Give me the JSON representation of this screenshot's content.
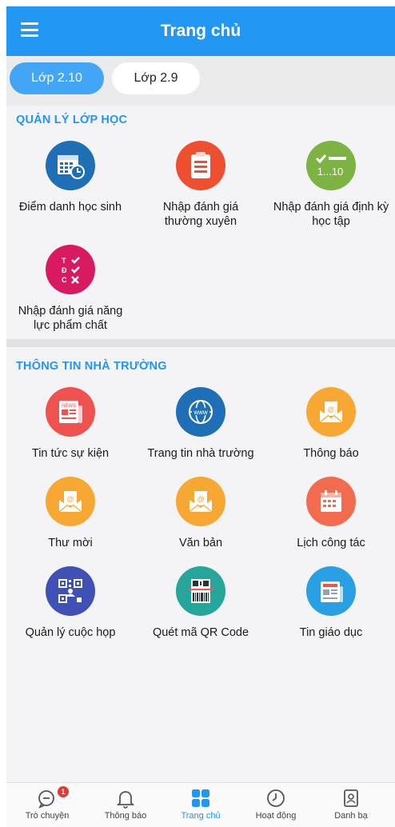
{
  "header": {
    "title": "Trang chủ"
  },
  "tabs": [
    {
      "label": "Lớp 2.10"
    },
    {
      "label": "Lớp 2.9"
    }
  ],
  "section1": {
    "title": "QUẢN LÝ LỚP HỌC",
    "items": [
      {
        "label": "Điểm danh học sinh",
        "icon": "calendar-clock-icon"
      },
      {
        "label": "Nhập đánh giá thường xuyên",
        "icon": "clipboard-icon"
      },
      {
        "label": "Nhập đánh giá định kỳ học tập",
        "icon": "check-score-icon",
        "icon_text": "1...10"
      },
      {
        "label": "Nhập đánh giá năng lực phẩm chất",
        "icon": "tdc-check-icon",
        "icon_text": [
          "T",
          "Đ",
          "C"
        ]
      }
    ]
  },
  "section2": {
    "title": "THÔNG TIN NHÀ TRƯỜNG",
    "items": [
      {
        "label": "Tin tức sự kiện",
        "icon": "newspaper-icon",
        "icon_text": "NEWS"
      },
      {
        "label": "Trang tin nhà trường",
        "icon": "globe-icon",
        "icon_text": "www"
      },
      {
        "label": "Thông báo",
        "icon": "mail-icon"
      },
      {
        "label": "Thư mời",
        "icon": "mail-icon"
      },
      {
        "label": "Văn bản",
        "icon": "mail-icon"
      },
      {
        "label": "Lịch công tác",
        "icon": "calendar-icon"
      },
      {
        "label": "Quản lý cuộc họp",
        "icon": "qr-meeting-icon"
      },
      {
        "label": "Quét mã QR Code",
        "icon": "qr-scan-icon"
      },
      {
        "label": "Tin giáo dục",
        "icon": "news-paper-icon"
      }
    ]
  },
  "bottom_nav": [
    {
      "label": "Trò chuyện",
      "icon": "chat-icon",
      "badge": "1"
    },
    {
      "label": "Thông báo",
      "icon": "bell-icon"
    },
    {
      "label": "Trang chủ",
      "icon": "grid-icon"
    },
    {
      "label": "Hoạt động",
      "icon": "clock-icon"
    },
    {
      "label": "Danh bạ",
      "icon": "contacts-icon"
    }
  ],
  "colors": {
    "primary": "#2196f3",
    "blue_icon": "#1e6fb5",
    "red_icon": "#ef4f31",
    "green_icon": "#7cb342",
    "pink_icon": "#d81b60",
    "orange_icon": "#f7a833",
    "salmon_icon": "#f26b4f",
    "indigo_icon": "#3f51b5",
    "teal_icon": "#26a69a",
    "sky_icon": "#29a0e3"
  }
}
